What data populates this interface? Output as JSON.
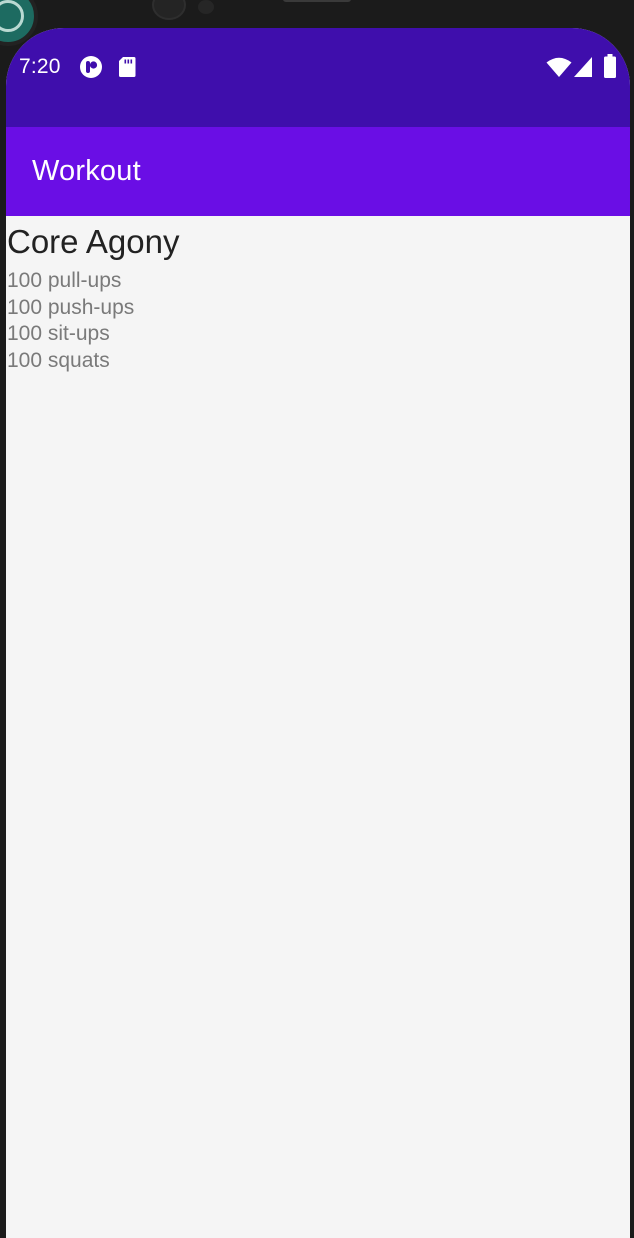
{
  "status_bar": {
    "time": "7:20",
    "icons": [
      "app-notification-icon",
      "sd-card-icon",
      "wifi-icon",
      "cell-signal-icon",
      "battery-icon"
    ]
  },
  "app_bar": {
    "title": "Workout"
  },
  "workout": {
    "name": "Core Agony",
    "exercises": [
      "100 pull-ups",
      "100 push-ups",
      "100 sit-ups",
      "100 squats"
    ]
  },
  "colors": {
    "status_bar": "#3f0eac",
    "app_bar": "#6a0ee5",
    "background": "#f5f5f5",
    "title_text": "#222222",
    "exercise_text": "#7a7a7a"
  }
}
